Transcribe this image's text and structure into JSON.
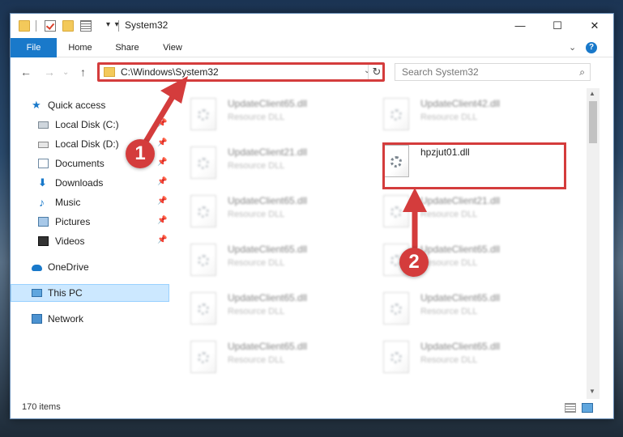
{
  "window": {
    "title": "System32",
    "controls": {
      "minimize": "—",
      "maximize": "☐",
      "close": "✕"
    }
  },
  "ribbon": {
    "tabs": [
      "File",
      "Home",
      "Share",
      "View"
    ],
    "help": "?"
  },
  "nav": {
    "back": "←",
    "forward": "→",
    "up": "↑",
    "address": "C:\\Windows\\System32",
    "search_placeholder": "Search System32"
  },
  "sidebar": {
    "items": [
      {
        "label": "Quick access",
        "icon": "star-icon",
        "pinned": false
      },
      {
        "label": "Local Disk (C:)",
        "icon": "drive-icon",
        "pinned": true
      },
      {
        "label": "Local Disk (D:)",
        "icon": "drive-icon",
        "pinned": true
      },
      {
        "label": "Documents",
        "icon": "documents-icon",
        "pinned": true
      },
      {
        "label": "Downloads",
        "icon": "downloads-icon",
        "pinned": true
      },
      {
        "label": "Music",
        "icon": "music-icon",
        "pinned": true
      },
      {
        "label": "Pictures",
        "icon": "pictures-icon",
        "pinned": true
      },
      {
        "label": "Videos",
        "icon": "videos-icon",
        "pinned": true
      },
      {
        "label": "OneDrive",
        "icon": "cloud-icon",
        "pinned": false
      },
      {
        "label": "This PC",
        "icon": "pc-icon",
        "pinned": false,
        "selected": true
      },
      {
        "label": "Network",
        "icon": "network-icon",
        "pinned": false
      }
    ]
  },
  "files": {
    "left": [
      {
        "name": "UpdateClient65.dll",
        "type": "Resource DLL"
      },
      {
        "name": "UpdateClient21.dll",
        "type": "Resource DLL"
      },
      {
        "name": "UpdateClient65.dll",
        "type": "Resource DLL"
      },
      {
        "name": "UpdateClient65.dll",
        "type": "Resource DLL"
      },
      {
        "name": "UpdateClient65.dll",
        "type": "Resource DLL"
      },
      {
        "name": "UpdateClient65.dll",
        "type": "Resource DLL"
      }
    ],
    "right": [
      {
        "name": "UpdateClient42.dll",
        "type": "Resource DLL"
      },
      {
        "name": "hpzjut01.dll",
        "type": ""
      },
      {
        "name": "UpdateClient21.dll",
        "type": "Resource DLL"
      },
      {
        "name": "UpdateClient65.dll",
        "type": "Resource DLL"
      },
      {
        "name": "UpdateClient65.dll",
        "type": "Resource DLL"
      },
      {
        "name": "UpdateClient65.dll",
        "type": "Resource DLL"
      }
    ]
  },
  "status": {
    "item_count": "170 items"
  },
  "callouts": {
    "one": "1",
    "two": "2"
  },
  "colors": {
    "accent": "#1979ca",
    "highlight": "#d43c3c",
    "selected_bg": "#cce8ff"
  }
}
